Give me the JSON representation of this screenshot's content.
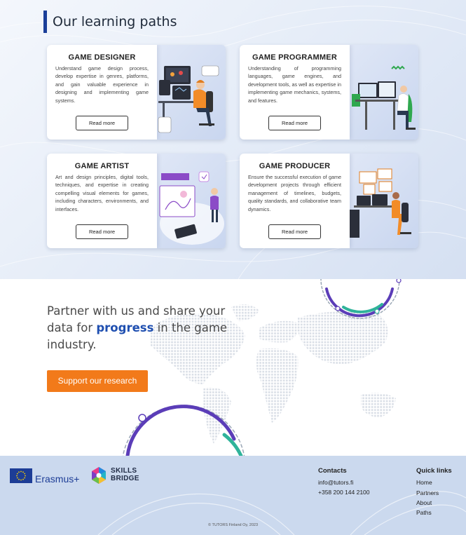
{
  "section": {
    "title": "Our learning paths"
  },
  "cards": [
    {
      "title": "GAME DESIGNER",
      "description": "Understand game design process, develop expertise in genres, platforms, and gain valuable experience in designing and implementing game systems.",
      "button": "Read more"
    },
    {
      "title": "GAME PROGRAMMER",
      "description": "Understanding of programming languages, game engines, and development tools, as well as expertise in implementing game mechanics, systems, and features.",
      "button": "Read more"
    },
    {
      "title": "GAME ARTIST",
      "description": "Art and design principles, digital tools, techniques, and expertise in creating compelling visual elements for games, including characters, environments, and interfaces.",
      "button": "Read more"
    },
    {
      "title": "GAME PRODUCER",
      "description": "Ensure the successful execution of game development projects through efficient management of timelines, budgets, quality standards, and collaborative team dynamics.",
      "button": "Read more"
    }
  ],
  "partner": {
    "line_before": "Partner with us and share your data for ",
    "highlight": "progress",
    "line_after": " in the game industry.",
    "cta": "Support our research",
    "accent": "#1f4fb0",
    "cta_color": "#f27a1a"
  },
  "footer": {
    "erasmus": "Erasmus+",
    "skills_1": "SKILLS",
    "skills_2": "BRIDGE",
    "contacts_title": "Contacts",
    "email": "info@tutors.fi",
    "phone": "+358 200 144 2100",
    "quick_title": "Quick links",
    "links": [
      "Home",
      "Partners",
      "About",
      "Paths"
    ],
    "copyright": "© TUTORS Finland Oy, 2023"
  }
}
